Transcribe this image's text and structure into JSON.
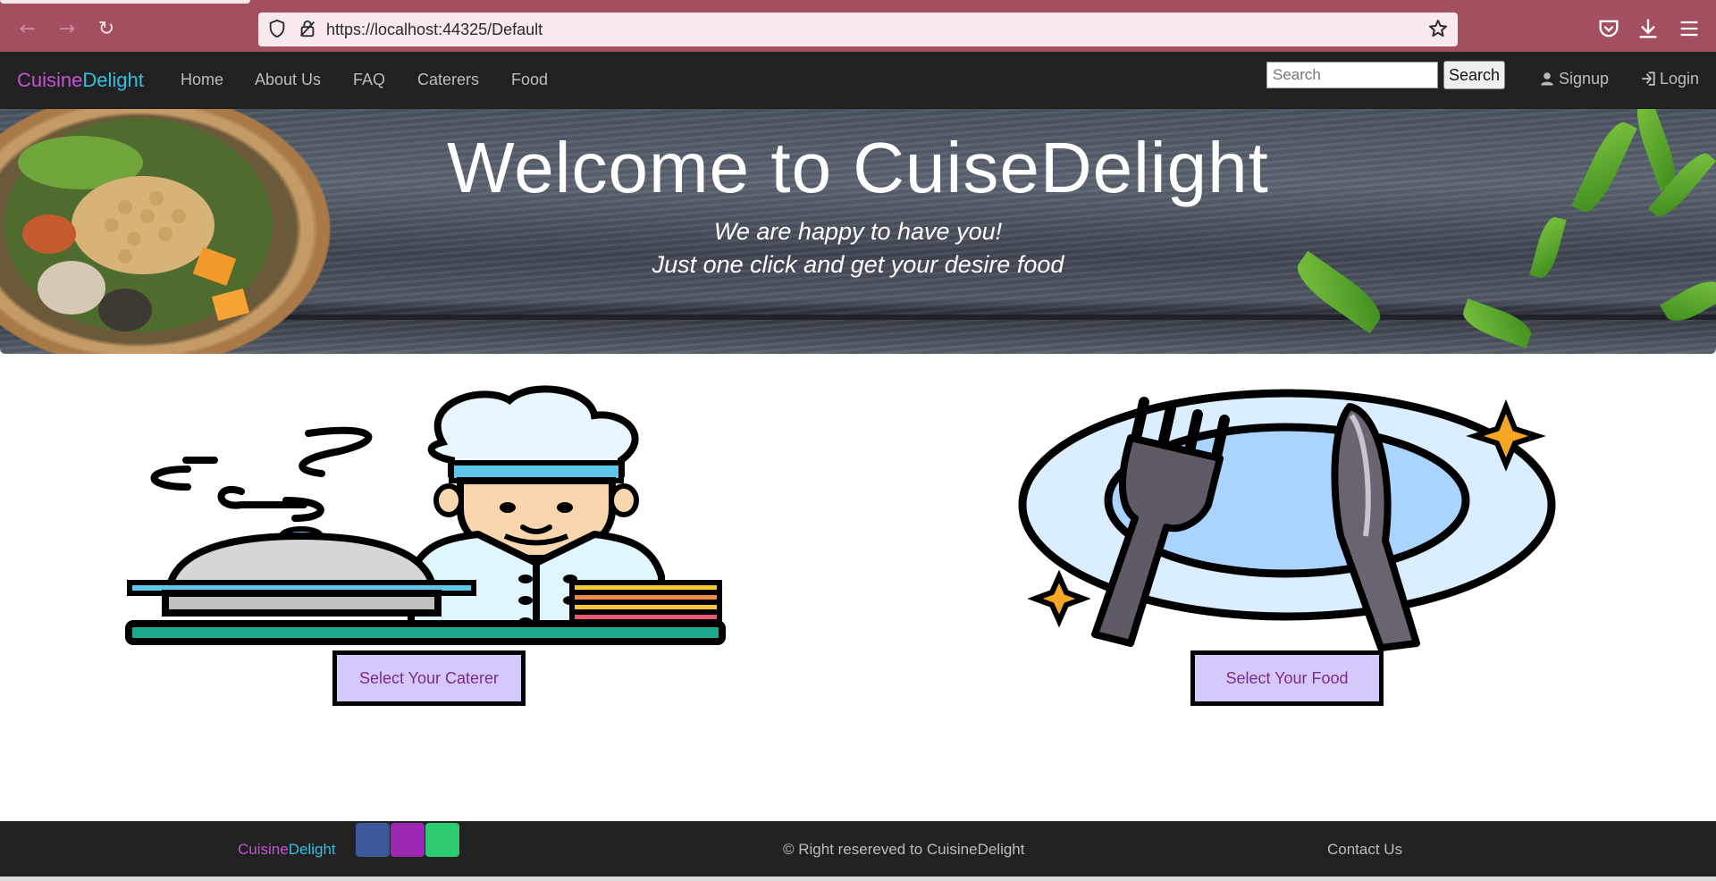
{
  "browser": {
    "url": "https://localhost:44325/Default"
  },
  "navbar": {
    "brand_part1": "Cuisine",
    "brand_part2": "Delight",
    "links": [
      "Home",
      "About Us",
      "FAQ",
      "Caterers",
      "Food"
    ],
    "search_placeholder": "Search",
    "search_button": "Search",
    "signup": "Signup",
    "login": "Login"
  },
  "hero": {
    "title": "Welcome to CuiseDelight",
    "line1": "We are happy to have you!",
    "line2": "Just one click and get your desire food"
  },
  "cards": {
    "caterer_button": "Select Your Caterer",
    "food_button": "Select Your Food"
  },
  "footer": {
    "brand_part1": "Cuisine",
    "brand_part2": "Delight",
    "copyright": "© Right resereved to CuisineDelight",
    "contact": "Contact Us",
    "social_colors": [
      "#3b5998",
      "#9c27b0",
      "#2ecc71"
    ]
  },
  "colors": {
    "browser_bar": "#a34f5f",
    "navbar": "#212121",
    "brand_purple": "#c453d4",
    "brand_cyan": "#2fc1e0",
    "button_fill": "#d5c8fb"
  }
}
